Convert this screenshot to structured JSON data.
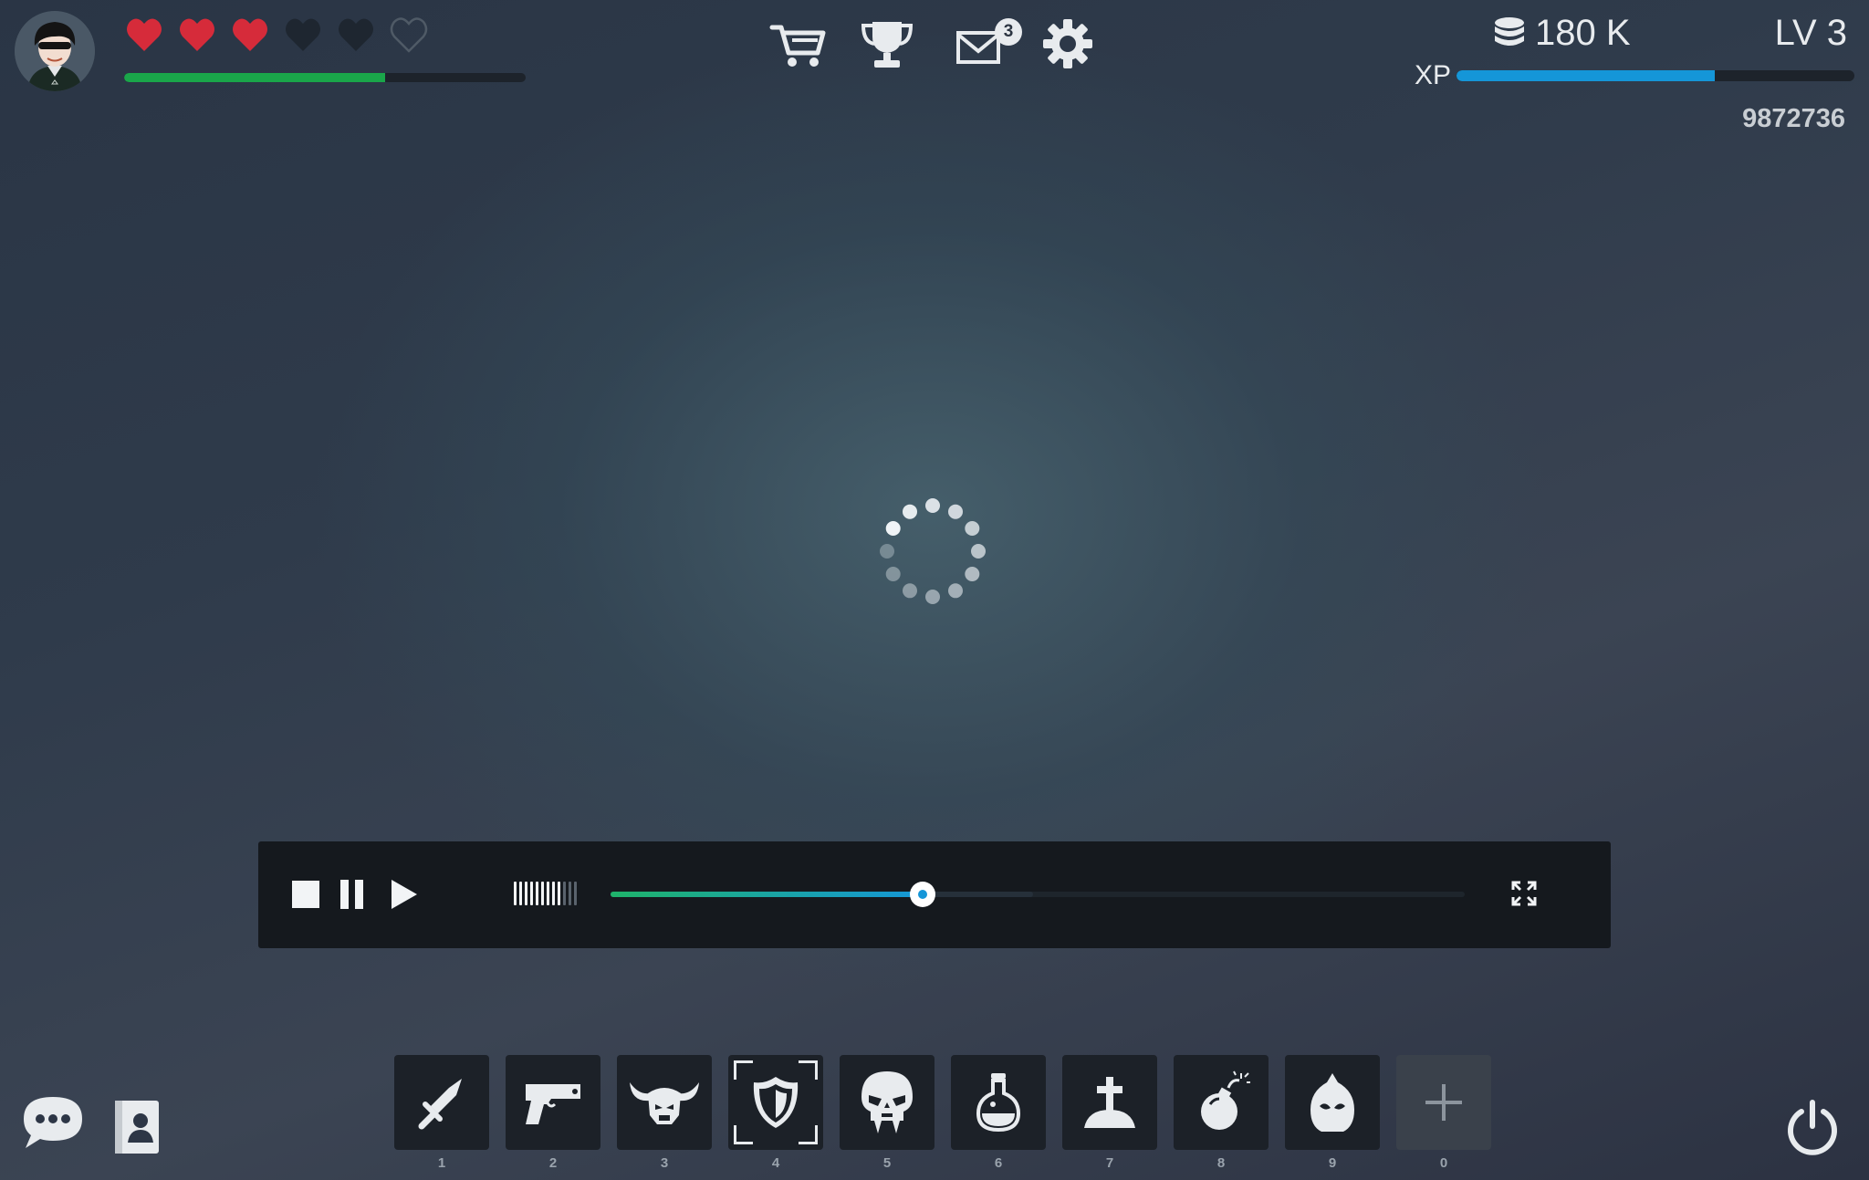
{
  "player": {
    "avatar_icon": "player-avatar",
    "hearts": [
      "full",
      "full",
      "full",
      "empty",
      "empty",
      "outline"
    ],
    "health_fraction": 0.65,
    "health_color": "#1aa64a",
    "heart_color": "#d62b3a"
  },
  "top_menu": {
    "items": [
      {
        "name": "shop",
        "icon": "cart-icon"
      },
      {
        "name": "achievements",
        "icon": "trophy-icon"
      },
      {
        "name": "mail",
        "icon": "mail-icon",
        "badge": "3"
      },
      {
        "name": "settings",
        "icon": "gear-icon"
      }
    ]
  },
  "stats": {
    "coins": "180 K",
    "level": "LV 3",
    "xp_label": "XP",
    "xp_fraction": 0.65,
    "xp_color": "#1596d8",
    "score": "9872736"
  },
  "loading": {
    "icon": "loading-spinner"
  },
  "media_player": {
    "volume_level": 0.7,
    "progress_fraction": 0.365,
    "buffered_fraction": 0.495,
    "controls": [
      "stop-icon",
      "pause-icon",
      "play-icon",
      "fullscreen-icon"
    ]
  },
  "hotbar": {
    "selected_index": 3,
    "slots": [
      {
        "key": "1",
        "icon": "sword-icon"
      },
      {
        "key": "2",
        "icon": "pistol-icon"
      },
      {
        "key": "3",
        "icon": "horned-helmet-icon"
      },
      {
        "key": "4",
        "icon": "shield-icon"
      },
      {
        "key": "5",
        "icon": "vampire-skull-icon"
      },
      {
        "key": "6",
        "icon": "potion-icon"
      },
      {
        "key": "7",
        "icon": "grave-icon"
      },
      {
        "key": "8",
        "icon": "bomb-icon"
      },
      {
        "key": "9",
        "icon": "hood-icon"
      },
      {
        "key": "0",
        "icon": "plus-icon"
      }
    ]
  },
  "bottom_bar": {
    "left": [
      "chat-icon",
      "contacts-icon"
    ],
    "right": [
      "power-icon"
    ]
  }
}
